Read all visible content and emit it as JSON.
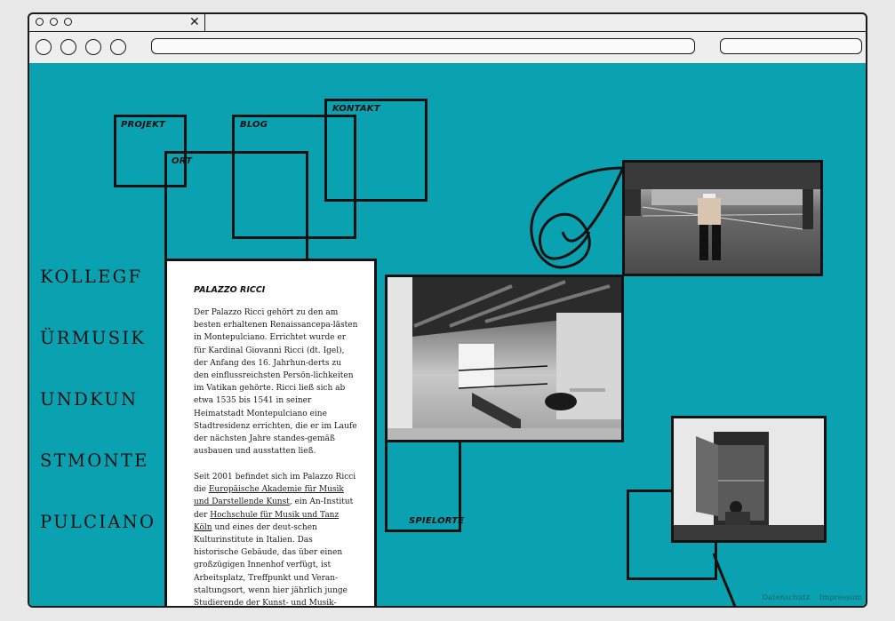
{
  "site": {
    "title_lines": [
      "KOLLEGF",
      "ÜRMUSIK",
      "UNDKUN",
      "STMONTE",
      "PULCIANO"
    ]
  },
  "nav": {
    "projekt": "PROJEKT",
    "ort": "ORT",
    "blog": "BLOG",
    "kontakt": "KONTAKT",
    "spielorte": "SPIELORTE"
  },
  "article": {
    "title": "PALAZZO RICCI",
    "p1": "Der Palazzo Ricci gehört zu den am besten erhaltenen Renaissancepa-lästen in Montepulciano. Errichtet wurde er für Kardinal Giovanni Ricci (dt. Igel), der Anfang des 16. Jahrhun-derts zu den einflussreichsten Persön-lichkeiten im Vatikan gehörte. Ricci ließ sich ab etwa 1535 bis 1541 in seiner Heimatstadt Montepulciano eine Stadtresidenz errichten, die er im Laufe der nächsten Jahre standes-gemäß ausbauen und ausstatten ließ.",
    "p2_a": "Seit 2001 befindet sich im Palazzo Ricci die ",
    "p2_link1": "Europäische Akademie für Musik und Darstellende Kunst",
    "p2_b": ", ein An-Institut der ",
    "p2_link2": "Hochschule für Musik und Tanz Köln",
    "p2_c": " und eines der deut-schen Kulturinstitute in Italien. Das historische Gebäude, das über einen großzügigen Innenhof verfügt, ist Arbeitsplatz, Treffpunkt und Veran-staltungsort, wenn hier jährlich junge Studierende der Kunst- und Musik-"
  },
  "footer": {
    "datenschutz": "Datenschutz",
    "impressum": "Impressum"
  },
  "colors": {
    "background": "#0aa2b1",
    "ink": "#111111",
    "frame": "#eeeeee"
  }
}
